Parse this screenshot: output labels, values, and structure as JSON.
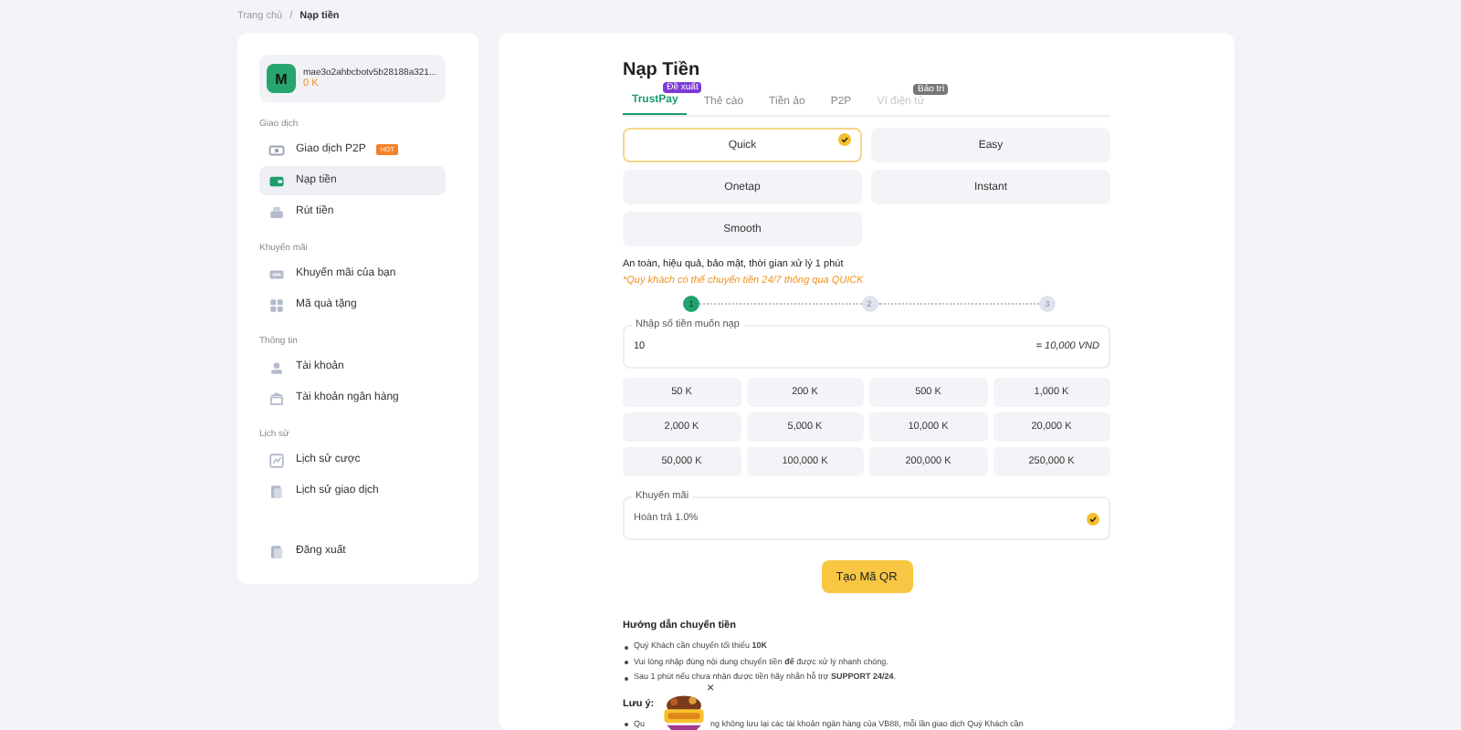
{
  "breadcrumb": [
    {
      "label": "Trang chủ",
      "selected": false
    },
    {
      "label": "Nạp tiền",
      "selected": true
    }
  ],
  "breadcrumb_separator": "/",
  "sidebar": {
    "user": {
      "avatar": "M",
      "name": "mae3o2ahbcbotv5b28188a321...",
      "balance": "0 K"
    },
    "sections": [
      {
        "title": "Giao dịch",
        "items": [
          {
            "label": "Giao dịch P2P",
            "badge": "HOT",
            "selected": false
          },
          {
            "label": "Nạp tiền",
            "selected": true
          },
          {
            "label": "Rút tiền",
            "selected": false
          }
        ]
      },
      {
        "title": "Khuyến mãi",
        "items": [
          {
            "label": "Khuyến mãi của bạn",
            "selected": false
          },
          {
            "label": "Mã quà tặng",
            "selected": false
          }
        ]
      },
      {
        "title": "Thông tin",
        "items": [
          {
            "label": "Tài khoản",
            "selected": false
          },
          {
            "label": "Tài khoản ngân hàng",
            "selected": false
          }
        ]
      },
      {
        "title": "Lịch sử",
        "items": [
          {
            "label": "Lịch sử cược",
            "selected": false
          },
          {
            "label": "Lịch sử giao dịch",
            "selected": false
          }
        ]
      }
    ],
    "logout": "Đăng xuất"
  },
  "main": {
    "title": "Nạp Tiền",
    "tabs": [
      {
        "label": "TrustPay",
        "selected": true,
        "disabled": false,
        "badge": "Đề xuất"
      },
      {
        "label": "Thẻ cào",
        "selected": false,
        "disabled": false
      },
      {
        "label": "Tiền ảo",
        "selected": false,
        "disabled": false
      },
      {
        "label": "P2P",
        "selected": false,
        "disabled": false
      },
      {
        "label": "Ví điện tử",
        "selected": false,
        "disabled": true,
        "badge": "Bảo trì"
      }
    ],
    "methods": [
      {
        "label": "Quick",
        "selected": true
      },
      {
        "label": "Easy",
        "selected": false
      },
      {
        "label": "Onetap",
        "selected": false
      },
      {
        "label": "Instant",
        "selected": false
      },
      {
        "label": "Smooth",
        "selected": false
      }
    ],
    "description": "An toàn, hiệu quả, bảo mật, thời gian xử lý 1 phút",
    "note": "*Quý khách có thể chuyển tiền 24/7 thông qua QUICK",
    "steps": [
      {
        "label": "1",
        "selected": true
      },
      {
        "label": "2",
        "selected": false
      },
      {
        "label": "3",
        "selected": false
      }
    ],
    "amount_field": {
      "label": "Nhập số tiền muốn nạp",
      "value": "10",
      "converted": "= 10,000 VND"
    },
    "amounts": [
      "50 K",
      "200 K",
      "500 K",
      "1,000 K",
      "2,000 K",
      "5,000 K",
      "10,000 K",
      "20,000 K",
      "50,000 K",
      "100,000 K",
      "200,000 K",
      "250,000 K"
    ],
    "promo_field": {
      "label": "Khuyến mãi",
      "value": "Hoàn trả 1.0%",
      "checked": true
    },
    "submit_button": "Tạo Mã QR",
    "guide": {
      "title": "Hướng dẫn chuyển tiền",
      "items": [
        "Quý Khách cần chuyển tối thiểu **10K**",
        "Vui lòng nhập đúng nội dung chuyển tiền **để** được xử lý nhanh chóng.",
        "Sau 1 phút nếu chưa nhận được tiền hãy nhắn hỗ trợ **SUPPORT 24/24**."
      ]
    },
    "notice": {
      "title": "Lưu ý:",
      "items": [
        {
          "visible_parts": [
            "Qu",
            "ng không lưu lại các tài khoản ngân hàng của VB88, mỗi lần giao dịch Quý Khách cần"
          ]
        }
      ]
    },
    "mini_widget": {
      "kind": "picture",
      "close": "×"
    }
  }
}
